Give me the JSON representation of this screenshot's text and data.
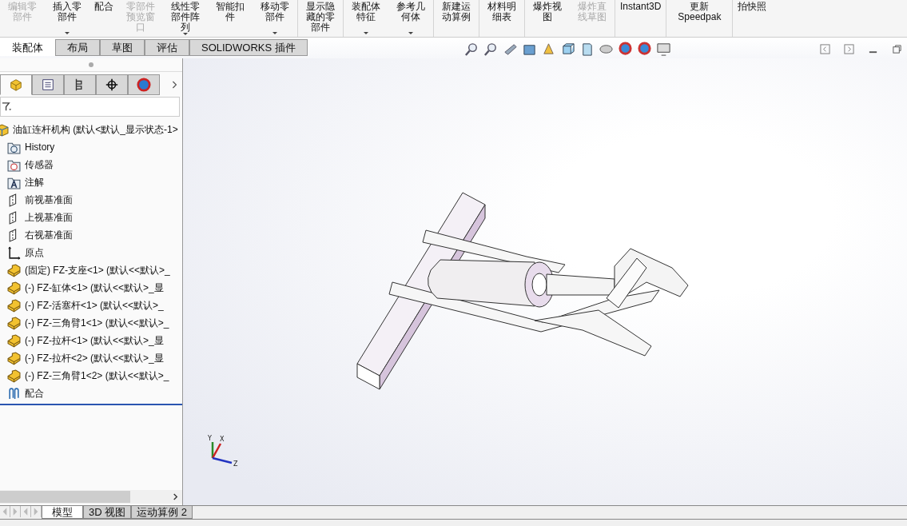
{
  "ribbon": [
    {
      "label": "编辑零部件",
      "disabled": true,
      "dropdown": false,
      "group_end": false
    },
    {
      "label": "插入零部件",
      "disabled": false,
      "dropdown": true,
      "group_end": false
    },
    {
      "label": "配合",
      "disabled": false,
      "dropdown": false,
      "group_end": false
    },
    {
      "label": "零部件预览窗口",
      "disabled": true,
      "dropdown": false,
      "group_end": false
    },
    {
      "label": "线性零部件阵列",
      "disabled": false,
      "dropdown": true,
      "group_end": false
    },
    {
      "label": "智能扣件",
      "disabled": false,
      "dropdown": false,
      "group_end": false
    },
    {
      "label": "移动零部件",
      "disabled": false,
      "dropdown": true,
      "group_end": true
    },
    {
      "label": "显示隐藏的零部件",
      "disabled": false,
      "dropdown": false,
      "group_end": true
    },
    {
      "label": "装配体特征",
      "disabled": false,
      "dropdown": true,
      "group_end": false
    },
    {
      "label": "参考几何体",
      "disabled": false,
      "dropdown": true,
      "group_end": true
    },
    {
      "label": "新建运动算例",
      "disabled": false,
      "dropdown": false,
      "group_end": true
    },
    {
      "label": "材料明细表",
      "disabled": false,
      "dropdown": false,
      "group_end": true
    },
    {
      "label": "爆炸视图",
      "disabled": false,
      "dropdown": false,
      "group_end": false
    },
    {
      "label": "爆炸直线草图",
      "disabled": true,
      "dropdown": false,
      "group_end": true
    },
    {
      "label": "Instant3D",
      "disabled": false,
      "dropdown": false,
      "group_end": true
    },
    {
      "label": "更新 Speedpak",
      "disabled": false,
      "dropdown": false,
      "group_end": true
    },
    {
      "label": "拍快照",
      "disabled": false,
      "dropdown": false,
      "group_end": false
    }
  ],
  "command_tabs": [
    {
      "label": "装配体",
      "selected": true
    },
    {
      "label": "布局",
      "selected": false
    },
    {
      "label": "草图",
      "selected": false
    },
    {
      "label": "评估",
      "selected": false
    },
    {
      "label": "SOLIDWORKS 插件",
      "selected": false
    }
  ],
  "panel_tabs": [
    {
      "kind": "tree",
      "selected": true
    },
    {
      "kind": "property",
      "selected": false
    },
    {
      "kind": "config",
      "selected": false
    },
    {
      "kind": "dim",
      "selected": false
    },
    {
      "kind": "display",
      "selected": false
    }
  ],
  "tree": {
    "label": "油缸连杆机构  (默认<默认_显示状态-1>",
    "children": [
      {
        "kind": "history",
        "label": "History"
      },
      {
        "kind": "sensor",
        "label": "传感器"
      },
      {
        "kind": "annotation",
        "label": "注解"
      },
      {
        "kind": "plane",
        "label": "前视基准面"
      },
      {
        "kind": "plane",
        "label": "上视基准面"
      },
      {
        "kind": "plane",
        "label": "右视基准面"
      },
      {
        "kind": "origin",
        "label": "原点"
      },
      {
        "kind": "part",
        "label": "(固定) FZ-支座<1> (默认<<默认>_"
      },
      {
        "kind": "part",
        "label": "(-) FZ-缸体<1> (默认<<默认>_显"
      },
      {
        "kind": "part",
        "label": "(-) FZ-活塞杆<1> (默认<<默认>_"
      },
      {
        "kind": "part",
        "label": "(-) FZ-三角臂1<1> (默认<<默认>_"
      },
      {
        "kind": "part",
        "label": "(-) FZ-拉杆<1> (默认<<默认>_显"
      },
      {
        "kind": "part",
        "label": "(-) FZ-拉杆<2> (默认<<默认>_显"
      },
      {
        "kind": "part",
        "label": "(-) FZ-三角臂1<2> (默认<<默认>_"
      },
      {
        "kind": "mates",
        "label": "配合"
      }
    ]
  },
  "triad": {
    "x": "X",
    "y": "Y",
    "z": "Z"
  },
  "bottom_tabs": [
    {
      "label": "模型",
      "selected": true
    },
    {
      "label": "3D 视图",
      "selected": false
    },
    {
      "label": "运动算例 2",
      "selected": false
    }
  ]
}
